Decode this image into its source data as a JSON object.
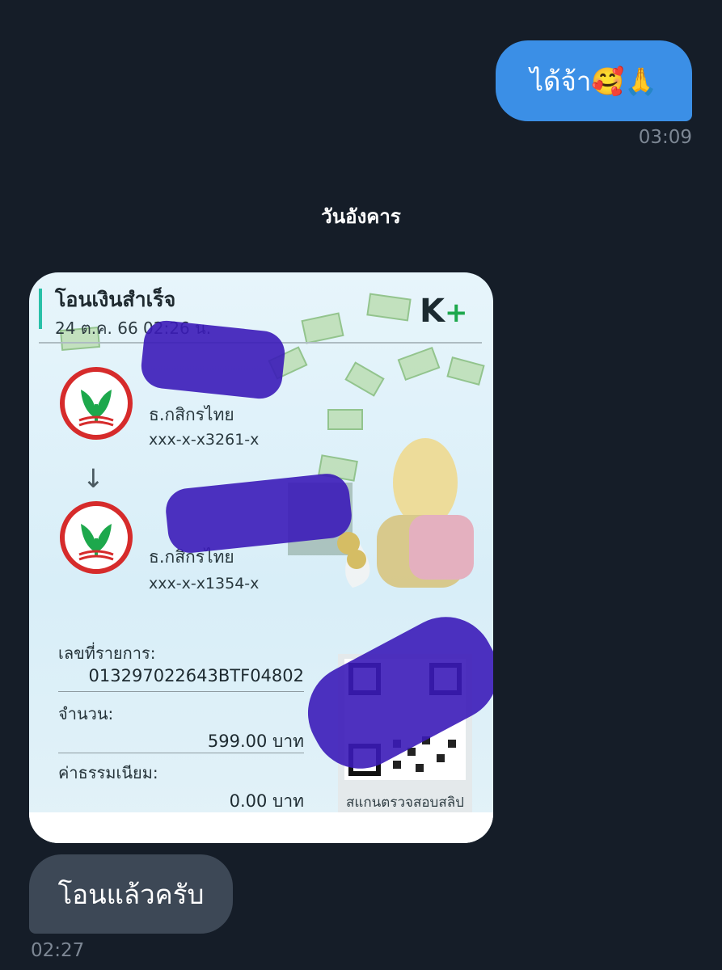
{
  "chat": {
    "outgoing_message": "ได้จ้า🥰🙏",
    "outgoing_time": "03:09",
    "day_separator": "วันอังคาร",
    "incoming_message": "โอนแล้วครับ",
    "incoming_time": "02:27"
  },
  "slip": {
    "title": "โอนเงินสำเร็จ",
    "date": "24 ต.ค. 66  02:26 น.",
    "brand": "K",
    "brand_plus": "+",
    "sender_bank": "ธ.กสิกรไทย",
    "sender_account": "xxx-x-x3261-x",
    "arrow": "↓",
    "receiver_bank": "ธ.กสิกรไทย",
    "receiver_account": "xxx-x-x1354-x",
    "ref_label": "เลขที่รายการ:",
    "ref_value": "013297022643BTF04802",
    "amount_label": "จำนวน:",
    "amount_value": "599.00 บาท",
    "fee_label": "ค่าธรรมเนียม:",
    "fee_value": "0.00 บาท",
    "qr_caption": "สแกนตรวจสอบสลิป"
  },
  "colors": {
    "background": "#151d28",
    "outgoing_bubble": "#3b8fe6",
    "incoming_bubble": "#3d4856",
    "redaction": "#3b1bb8",
    "kbank_green": "#1da84c"
  }
}
